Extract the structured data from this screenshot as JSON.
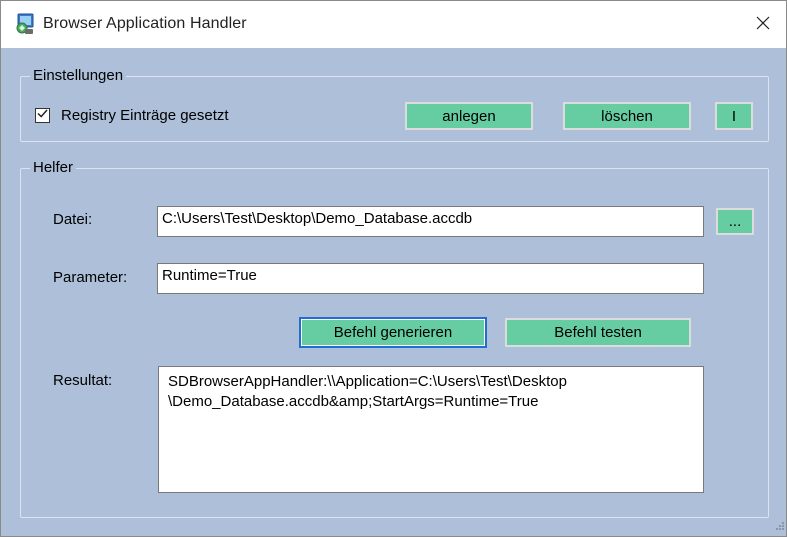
{
  "window": {
    "title": "Browser Application Handler",
    "close_glyph": "✕"
  },
  "settings": {
    "legend": "Einstellungen",
    "checkbox_label": "Registry Einträge gesetzt",
    "checkbox_checked": true,
    "create_button": "anlegen",
    "delete_button": "löschen",
    "info_button": "I"
  },
  "helper": {
    "legend": "Helfer",
    "file_label": "Datei:",
    "file_value": "C:\\Users\\Test\\Desktop\\Demo_Database.accdb",
    "browse_button": "...",
    "param_label": "Parameter:",
    "param_value": "Runtime=True",
    "generate_button": "Befehl generieren",
    "test_button": "Befehl testen",
    "result_label": "Resultat:",
    "result_line1": "SDBrowserAppHandler:\\\\Application=C:\\Users\\Test\\Desktop",
    "result_line2": "\\Demo_Database.accdb&amp;StartArgs=Runtime=True"
  },
  "colors": {
    "window_background": "#aec0d9",
    "button_accent": "#66cda3",
    "focus_border": "#1e6fd0",
    "titlebar": "#ffffff"
  },
  "icons": {
    "app": "application-icon",
    "close": "close-icon",
    "check": "checkmark-icon",
    "grip": "resize-grip-icon"
  }
}
